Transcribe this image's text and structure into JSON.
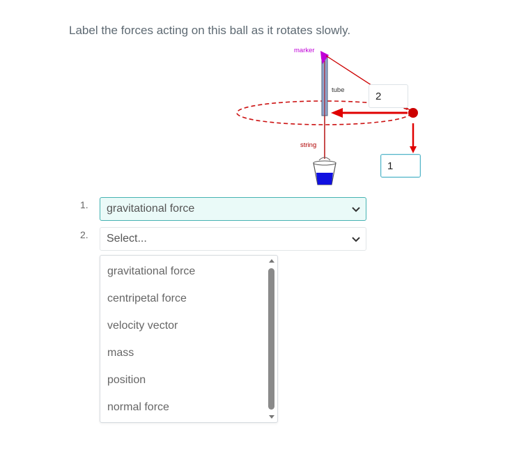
{
  "question": "Label the forces acting on this ball as it rotates slowly.",
  "figure": {
    "marker_label": "marker",
    "tube_label": "tube",
    "string_label": "string",
    "label_box_2": "2",
    "label_box_1": "1",
    "colors": {
      "arrow": "#e00000",
      "ball": "#cc0000",
      "orbit": "#cc1111",
      "marker": "#c000d8",
      "bucket_water": "#1010e0",
      "tube": "#8fa9d0"
    }
  },
  "answers": [
    {
      "number": "1.",
      "value": "gravitational force"
    },
    {
      "number": "2.",
      "value": "Select..."
    }
  ],
  "dropdown": {
    "options": [
      "gravitational force",
      "centripetal force",
      "velocity vector",
      "mass",
      "position",
      "normal force"
    ]
  }
}
